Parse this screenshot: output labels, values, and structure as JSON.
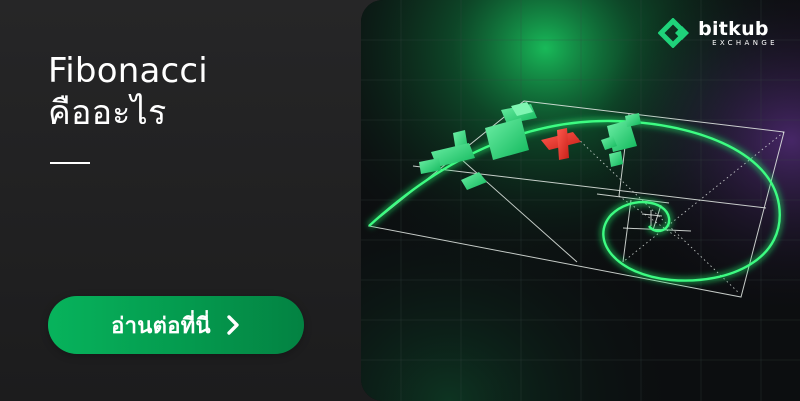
{
  "banner": {
    "title_line1": "Fibonacci",
    "title_line2": "คืออะไร",
    "cta_label": "อ่านต่อที่นี่",
    "cta_icon": "chevron-right-icon"
  },
  "brand": {
    "name": "bitkub",
    "sub": "EXCHANGE",
    "logo_icon": "bitkub-logo-icon"
  },
  "colors": {
    "accent": "#07b35c",
    "candle_up": "#1fd27a",
    "candle_down": "#e5332a",
    "spiral": "#1ee86a",
    "background": "#1e1e1f"
  }
}
